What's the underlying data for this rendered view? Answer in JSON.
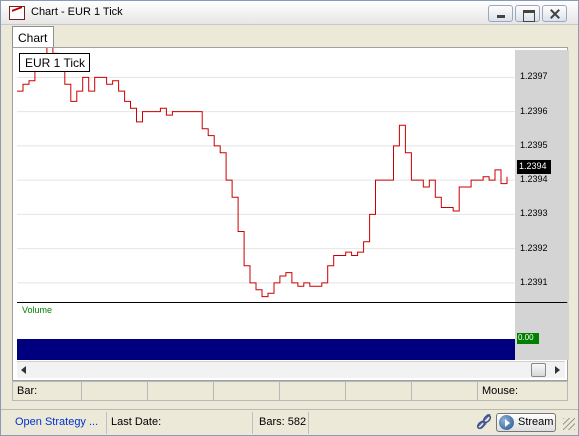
{
  "window": {
    "title": "Chart - EUR 1 Tick",
    "icon": "chart-window-icon"
  },
  "tabs": [
    {
      "label": "Chart"
    }
  ],
  "chart": {
    "legend": "EUR 1 Tick",
    "price_ticks": [
      "1.2397",
      "1.2396",
      "1.2395",
      "1.2394",
      "1.2393",
      "1.2392",
      "1.2391"
    ],
    "current_price": "1.2394",
    "line_color": "#cc0000"
  },
  "chart_data": {
    "type": "line",
    "ylim": [
      1.23905,
      1.23978
    ],
    "series": [
      {
        "values": [
          1.23966,
          1.23968,
          1.23969,
          1.23974,
          1.23976,
          1.23979,
          1.23977,
          1.23972,
          1.23968,
          1.23963,
          1.23966,
          1.2397,
          1.23966,
          1.2397,
          1.2397,
          1.23968,
          1.23969,
          1.23966,
          1.23963,
          1.23961,
          1.23957,
          1.2396,
          1.2396,
          1.2396,
          1.23961,
          1.23959,
          1.2396,
          1.2396,
          1.2396,
          1.2396,
          1.2396,
          1.23955,
          1.23953,
          1.2395,
          1.23948,
          1.2394,
          1.23935,
          1.23925,
          1.23915,
          1.2391,
          1.23908,
          1.23906,
          1.23907,
          1.2391,
          1.23912,
          1.23913,
          1.2391,
          1.23909,
          1.2391,
          1.23909,
          1.23909,
          1.2391,
          1.23915,
          1.23918,
          1.23918,
          1.23919,
          1.23918,
          1.23919,
          1.23922,
          1.2393,
          1.2394,
          1.2394,
          1.2394,
          1.2395,
          1.23956,
          1.23948,
          1.2394,
          1.2394,
          1.23938,
          1.2394,
          1.23935,
          1.23932,
          1.23932,
          1.23931,
          1.23938,
          1.23938,
          1.2394,
          1.2394,
          1.23941,
          1.2394,
          1.23943,
          1.23939,
          1.23941
        ]
      }
    ]
  },
  "volume": {
    "label": "Volume",
    "value": "0.00",
    "bar_color": "#00007f"
  },
  "infobar": {
    "bar_label": "Bar:",
    "mouse_label": "Mouse:"
  },
  "status": {
    "strategy": "Open Strategy ...",
    "last_date": "Last Date:",
    "bars": "Bars: 582",
    "stream_label": "Stream"
  }
}
